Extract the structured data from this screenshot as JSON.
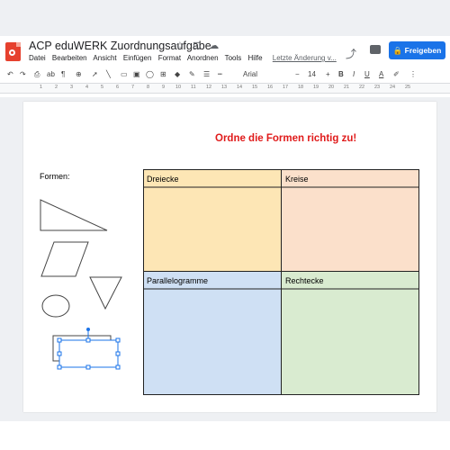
{
  "app": {
    "title": "ACP eduWERK Zuordnungsaufgabe",
    "share_label": "Freigeben",
    "last_change": "Letzte Änderung v..."
  },
  "menu": [
    "Datei",
    "Bearbeiten",
    "Ansicht",
    "Einfügen",
    "Format",
    "Anordnen",
    "Tools",
    "Hilfe"
  ],
  "toolbar": {
    "font": "Arial",
    "font_size": "14",
    "minus": "−",
    "plus": "+",
    "bold": "B",
    "italic": "I",
    "underline": "U",
    "text_color": "A"
  },
  "ruler": [
    "1",
    "2",
    "3",
    "4",
    "5",
    "6",
    "7",
    "8",
    "9",
    "10",
    "11",
    "12",
    "13",
    "14",
    "15",
    "16",
    "17",
    "18",
    "19",
    "20",
    "21",
    "22",
    "23",
    "24",
    "25"
  ],
  "slide": {
    "heading": "Ordne die Formen richtig zu!",
    "shapes_label": "Formen:",
    "cells": [
      {
        "label": "Dreiecke",
        "color": "#fde6b5"
      },
      {
        "label": "Kreise",
        "color": "#fbe0cb"
      },
      {
        "label": "Parallelogramme",
        "color": "#cfe0f4"
      },
      {
        "label": "Rechtecke",
        "color": "#d9ebd0"
      }
    ]
  },
  "colors": {
    "accent": "#1a73e8",
    "heading": "#e01b1b",
    "brand": "#e6412e"
  }
}
